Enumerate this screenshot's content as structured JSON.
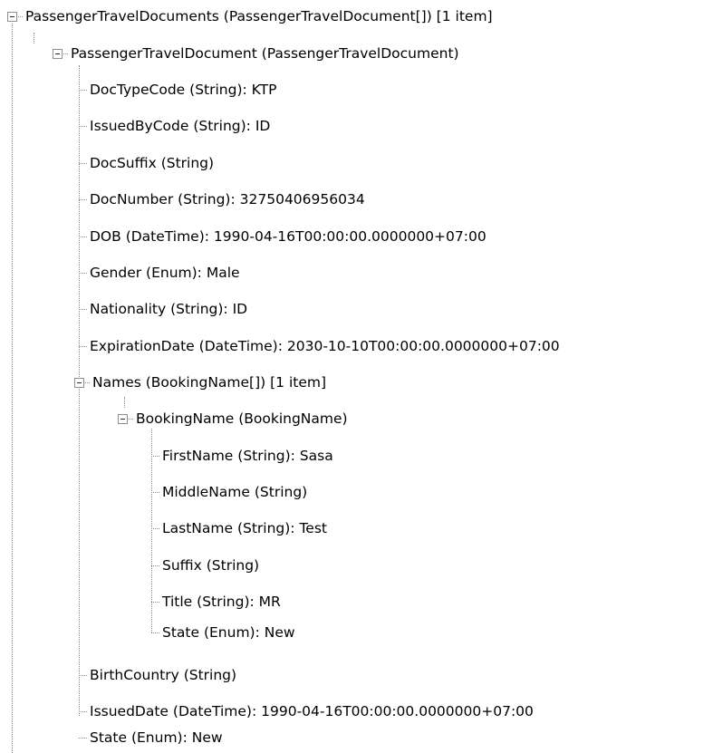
{
  "tree": {
    "root": {
      "label": "PassengerTravelDocuments (PassengerTravelDocument[]) [1 item]",
      "expand_icon": "minus-box-icon",
      "child": {
        "label": "PassengerTravelDocument (PassengerTravelDocument)",
        "expand_icon": "minus-box-icon",
        "fields_before": [
          "DocTypeCode (String): KTP",
          "IssuedByCode (String): ID",
          "DocSuffix (String)",
          "DocNumber (String): 32750406956034",
          "DOB (DateTime): 1990-04-16T00:00:00.0000000+07:00",
          "Gender (Enum): Male",
          "Nationality (String): ID",
          "ExpirationDate (DateTime): 2030-10-10T00:00:00.0000000+07:00"
        ],
        "names": {
          "label": "Names (BookingName[]) [1 item]",
          "expand_icon": "minus-box-icon",
          "booking_name": {
            "label": "BookingName (BookingName)",
            "expand_icon": "minus-box-icon",
            "fields": [
              "FirstName (String): Sasa",
              "MiddleName (String)",
              "LastName (String): Test",
              "Suffix (String)",
              "Title (String): MR",
              "State (Enum): New"
            ]
          }
        },
        "fields_after": [
          "BirthCountry (String)",
          "IssuedDate (DateTime): 1990-04-16T00:00:00.0000000+07:00",
          "State (Enum): New"
        ]
      }
    }
  }
}
